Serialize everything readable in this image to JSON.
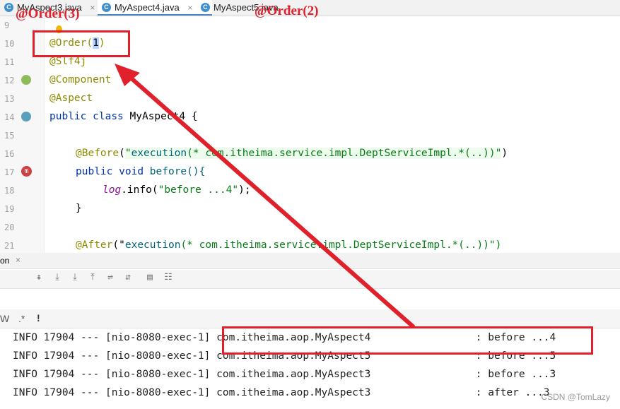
{
  "tabs": [
    {
      "label": "MyAspect3.java",
      "icon": "class-icon"
    },
    {
      "label": "MyAspect4.java",
      "icon": "class-icon",
      "active": true
    },
    {
      "label": "MyAspect5.java",
      "icon": "class-icon"
    }
  ],
  "tab_close": "×",
  "overlay": {
    "left_label": "@Order(3)",
    "right_label": "@Order(2)"
  },
  "editor": {
    "lines": [
      {
        "no": "9"
      },
      {
        "no": "10"
      },
      {
        "no": "11"
      },
      {
        "no": "12"
      },
      {
        "no": "13"
      },
      {
        "no": "14"
      },
      {
        "no": "15"
      },
      {
        "no": "16"
      },
      {
        "no": "17"
      },
      {
        "no": "18"
      },
      {
        "no": "19"
      },
      {
        "no": "20"
      },
      {
        "no": "21"
      }
    ],
    "order_annotation": "@Order(",
    "order_value": "1",
    "order_close": ")",
    "slf4j": "@Slf4j",
    "component": "@Component",
    "aspect": "@Aspect",
    "class_kw_public": "public",
    "class_kw_class": "class",
    "class_name": "MyAspect4 {",
    "before_ann": "@Before",
    "before_paren_open": "(",
    "before_expr_fn": "execution",
    "before_expr_rest": "(* com.itheima.service.impl.DeptServiceImpl.*(..))\"",
    "before_paren_close": ")",
    "before_sig_public": "public",
    "before_sig_void": "void",
    "before_sig_name": "before(){",
    "log_var": "log",
    "log_call": ".info(",
    "log_str": "\"before ...4\"",
    "log_end": ");",
    "close_brace": "}",
    "after_ann": "@After",
    "after_expr_fn": "execution",
    "after_expr_rest": "(* com.itheima.service.impl.DeptServiceImpl.*(..))\")"
  },
  "panel": {
    "tab_label": "on",
    "filter_w": "W",
    "filter_regex": ".*",
    "filter_bang": "!"
  },
  "log": [
    {
      "level": "INFO",
      "pid": "17904",
      "sep": "---",
      "thread": "[nio-8080-exec-1]",
      "logger": "com.itheima.aop.MyAspect4",
      "msg": ": before ...4"
    },
    {
      "level": "INFO",
      "pid": "17904",
      "sep": "---",
      "thread": "[nio-8080-exec-1]",
      "logger": "com.itheima.aop.MyAspect5",
      "msg": ": before ...5"
    },
    {
      "level": "INFO",
      "pid": "17904",
      "sep": "---",
      "thread": "[nio-8080-exec-1]",
      "logger": "com.itheima.aop.MyAspect3",
      "msg": ": before ...3"
    },
    {
      "level": "INFO",
      "pid": "17904",
      "sep": "---",
      "thread": "[nio-8080-exec-1]",
      "logger": "com.itheima.aop.MyAspect3",
      "msg": ": after ...3"
    }
  ],
  "watermark": "CSDN @TomLazy",
  "colors": {
    "annotation_red": "#e0202a",
    "tab_accent": "#4a88c7"
  }
}
